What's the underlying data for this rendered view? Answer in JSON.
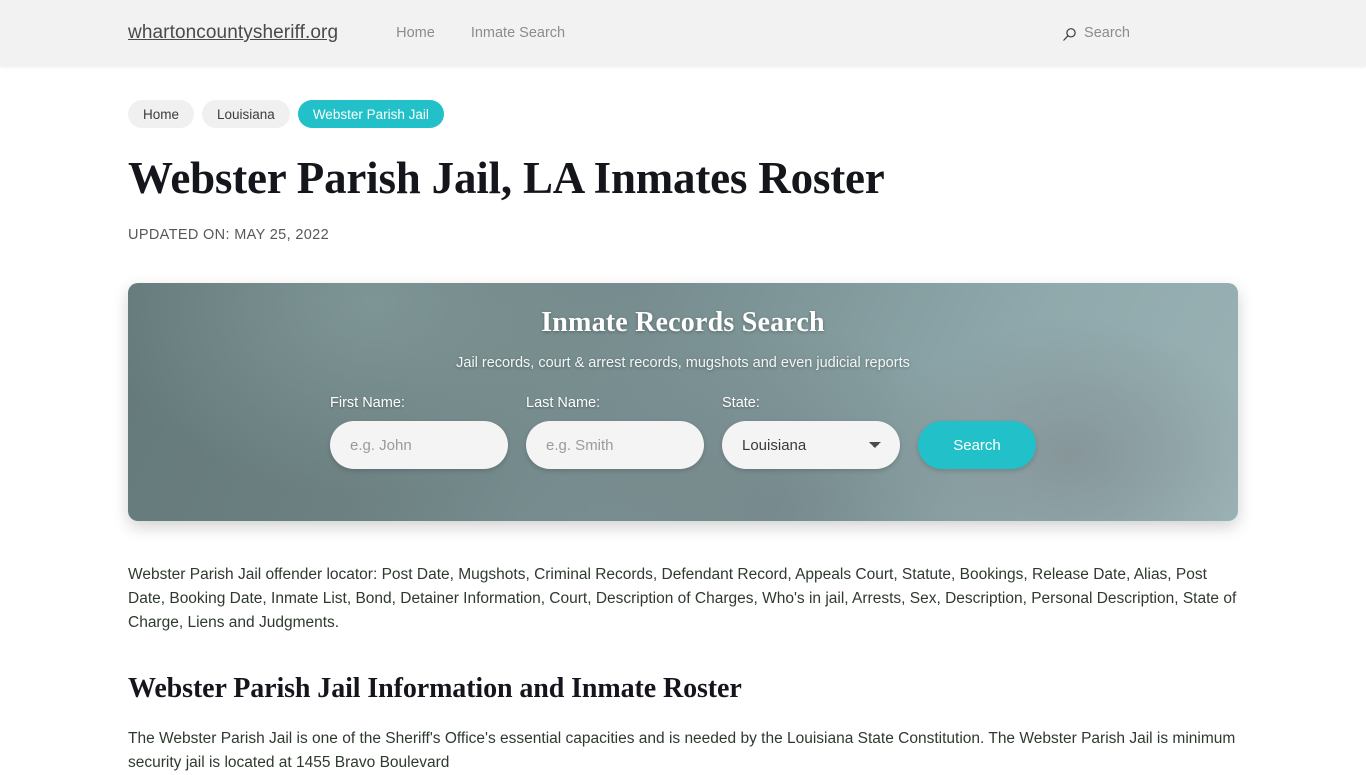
{
  "header": {
    "brand": "whartoncountysheriff.org",
    "nav": [
      {
        "label": "Home"
      },
      {
        "label": "Inmate Search"
      }
    ],
    "search": {
      "icon": "search-icon",
      "label": "Search"
    }
  },
  "breadcrumb": [
    {
      "label": "Home",
      "current": false
    },
    {
      "label": "Louisiana",
      "current": false
    },
    {
      "label": "Webster Parish Jail",
      "current": true
    }
  ],
  "article": {
    "title": "Webster Parish Jail, LA Inmates Roster",
    "updated_on": "UPDATED ON: MAY 25, 2022",
    "lead_paragraph": "Webster Parish Jail offender locator: Post Date, Mugshots, Criminal Records, Defendant Record, Appeals Court, Statute, Bookings, Release Date, Alias, Post Date, Booking Date, Inmate List, Bond, Detainer Information, Court, Description of Charges, Who's in jail, Arrests, Sex, Description, Personal Description, State of Charge, Liens and Judgments.",
    "section_heading": "Webster Parish Jail Information and Inmate Roster",
    "body_paragraph": "The Webster Parish Jail is one of the Sheriff's Office's essential capacities and is needed by the Louisiana State Constitution. The Webster Parish Jail is minimum security jail is located at 1455 Bravo Boulevard"
  },
  "hero": {
    "title": "Inmate Records Search",
    "subtitle": "Jail records, court & arrest records, mugshots and even judicial reports",
    "fields": {
      "first_name": {
        "label": "First Name:",
        "placeholder": "e.g. John",
        "value": ""
      },
      "last_name": {
        "label": "Last Name:",
        "placeholder": "e.g. Smith",
        "value": ""
      },
      "state": {
        "label": "State:",
        "selected": "Louisiana",
        "options": [
          "Louisiana"
        ]
      }
    },
    "submit_label": "Search"
  },
  "colors": {
    "accent_teal": "#22c0c8",
    "header_background": "#f2f2f2",
    "hero_gradient_start": "#64797a",
    "hero_gradient_end": "#9bb2b4",
    "title_text": "#14161c",
    "body_text": "#2f3a2f"
  }
}
